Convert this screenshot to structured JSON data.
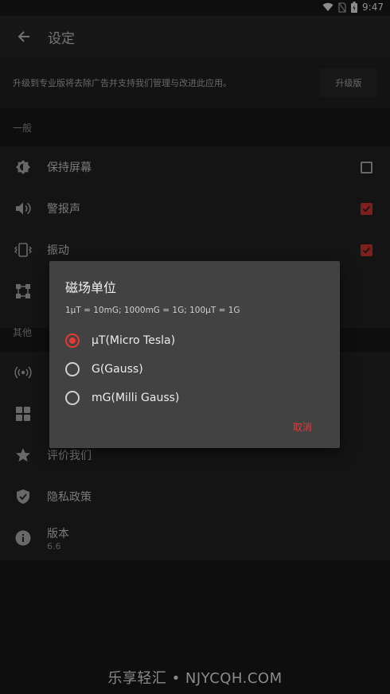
{
  "status": {
    "time": "9:47"
  },
  "appbar": {
    "title": "设定"
  },
  "banner": {
    "text": "升级到专业版将去除广告并支持我们管理与改进此应用。",
    "button_label": "升级版"
  },
  "sections": {
    "general": "一般",
    "other": "其他"
  },
  "general_items": [
    {
      "label": "保持屏幕",
      "icon": "brightness-icon",
      "checked": false
    },
    {
      "label": "警报声",
      "icon": "volume-icon",
      "checked": true
    },
    {
      "label": "振动",
      "icon": "vibration-icon",
      "checked": true
    }
  ],
  "other_items": [
    {
      "label": "评价我们",
      "icon": "star-icon"
    },
    {
      "label": "隐私政策",
      "icon": "shield-icon"
    },
    {
      "label": "版本",
      "sublabel": "6.6",
      "icon": "info-icon"
    }
  ],
  "dialog": {
    "title": "磁场单位",
    "description": "1μT = 10mG; 1000mG = 1G; 100μT = 1G",
    "options": [
      {
        "label": "μT(Micro Tesla)",
        "selected": true
      },
      {
        "label": "G(Gauss)",
        "selected": false
      },
      {
        "label": "mG(Milli Gauss)",
        "selected": false
      }
    ],
    "cancel_label": "取消"
  },
  "watermark": "乐享轻汇 • NJYCQH.COM",
  "colors": {
    "accent": "#e53935",
    "background": "#1b1b1b",
    "dialog": "#424242"
  }
}
